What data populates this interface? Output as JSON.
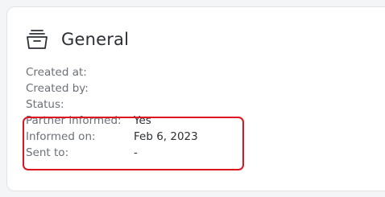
{
  "section": {
    "title": "General",
    "icon": "archive-box-icon"
  },
  "fields": [
    {
      "label": "Created at:",
      "value": ""
    },
    {
      "label": "Created by:",
      "value": ""
    },
    {
      "label": "Status:",
      "value": ""
    },
    {
      "label": "Partner informed:",
      "value": "Yes"
    },
    {
      "label": "Informed on:",
      "value": "Feb 6, 2023"
    },
    {
      "label": "Sent to:",
      "value": "-"
    }
  ],
  "colors": {
    "highlight": "#e0141e",
    "label": "#6b7078",
    "value": "#2b2f36"
  }
}
